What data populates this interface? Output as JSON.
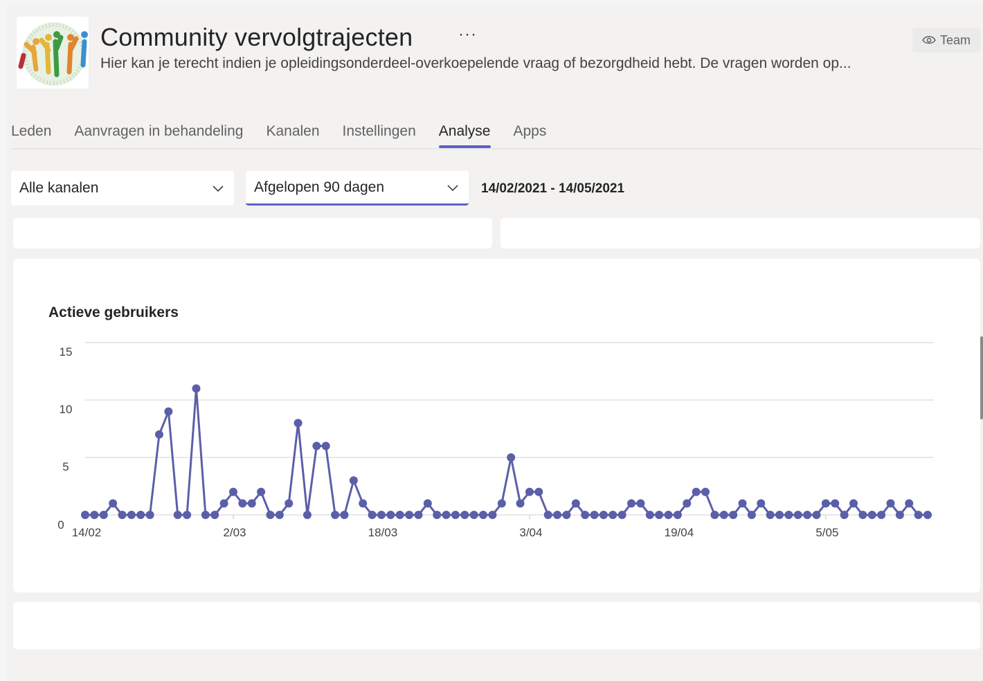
{
  "header": {
    "title": "Community vervolgtrajecten",
    "more_label": "···",
    "description": "Hier kan je terecht indien je opleidingsonderdeel-overkoepelende vraag of bezorgdheid hebt. De vragen worden op...",
    "team_button_label": "Team"
  },
  "tabs": [
    {
      "label": "Leden",
      "active": false
    },
    {
      "label": "Aanvragen in behandeling",
      "active": false
    },
    {
      "label": "Kanalen",
      "active": false
    },
    {
      "label": "Instellingen",
      "active": false
    },
    {
      "label": "Analyse",
      "active": true
    },
    {
      "label": "Apps",
      "active": false
    }
  ],
  "filters": {
    "channel_value": "Alle kanalen",
    "period_value": "Afgelopen 90 dagen",
    "date_range": "14/02/2021 - 14/05/2021"
  },
  "colors": {
    "accent": "#5b5fc7",
    "series": "#5b5fa8",
    "gridline": "#e1e1e1"
  },
  "chart_data": {
    "type": "line",
    "title": "Actieve gebruikers",
    "xlabel": "",
    "ylabel": "",
    "ylim": [
      0,
      15
    ],
    "yticks": [
      0,
      5,
      10,
      15
    ],
    "xtick_labels": [
      "14/02",
      "2/03",
      "18/03",
      "3/04",
      "19/04",
      "5/05"
    ],
    "xtick_day_index": [
      0,
      16,
      32,
      48,
      64,
      80
    ],
    "grid": true,
    "series": [
      {
        "values": [
          0,
          0,
          0,
          1,
          0,
          0,
          0,
          0,
          7,
          9,
          0,
          0,
          11,
          0,
          0,
          1,
          2,
          1,
          1,
          2,
          0,
          0,
          1,
          8,
          0,
          6,
          6,
          0,
          0,
          3,
          1,
          0,
          0,
          0,
          0,
          0,
          0,
          1,
          0,
          0,
          0,
          0,
          0,
          0,
          0,
          1,
          5,
          1,
          2,
          2,
          0,
          0,
          0,
          1,
          0,
          0,
          0,
          0,
          0,
          1,
          1,
          0,
          0,
          0,
          0,
          1,
          2,
          2,
          0,
          0,
          0,
          1,
          0,
          1,
          0,
          0,
          0,
          0,
          0,
          0,
          1,
          1,
          0,
          1,
          0,
          0,
          0,
          1,
          0,
          1,
          0,
          0
        ]
      }
    ]
  }
}
